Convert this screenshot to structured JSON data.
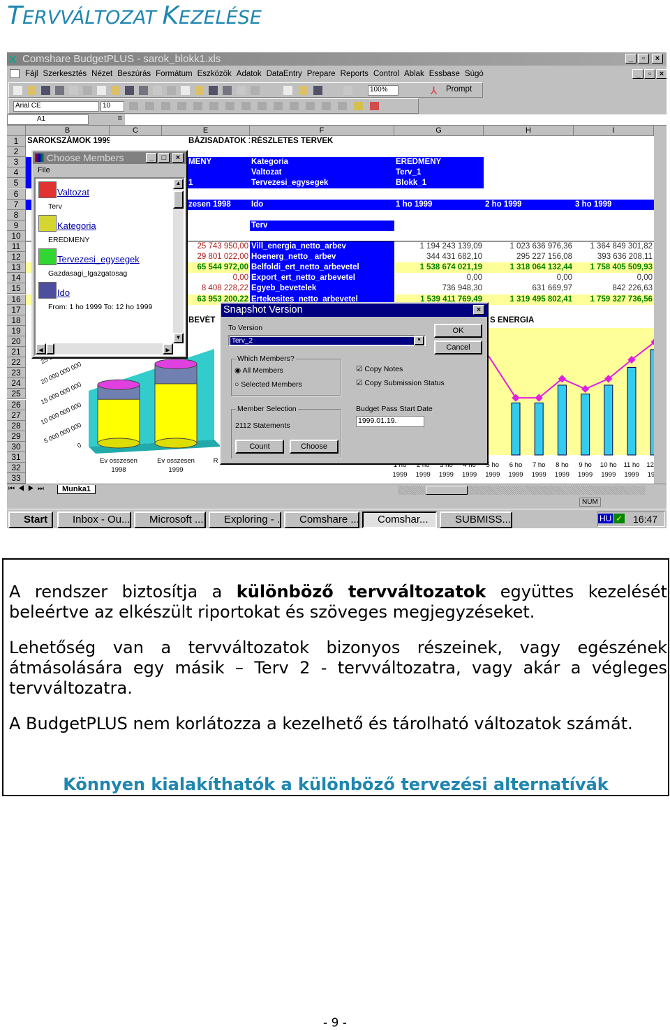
{
  "heading": {
    "first": "T",
    "rest1": "ERVVÁLTOZAT ",
    "k": "K",
    "rest2": "EZELÉSE"
  },
  "app": {
    "title": "Comshare BudgetPLUS - sarok_blokk1.xls",
    "menu": [
      "Fájl",
      "Szerkesztés",
      "Nézet",
      "Beszúrás",
      "Formátum",
      "Eszközök",
      "Adatok",
      "DataEntry",
      "Prepare",
      "Reports",
      "Control",
      "Ablak",
      "Essbase",
      "Súgó"
    ],
    "zoom": "100%",
    "prompt_label": "Prompt",
    "font_name": "Arial CE",
    "font_size": "10",
    "name_box": "A1",
    "formula_eq": "=",
    "columns": [
      "B",
      "C",
      "E",
      "F",
      "G",
      "H",
      "I"
    ],
    "cells": {
      "B1": "SAROKSZÁMOK 1999",
      "E1": "BÁZISADATOK 1998",
      "F1": "RÉSZLETES TERVEK",
      "E3": "MENY",
      "F3": "Kategoria",
      "G3": "EREDMENY",
      "F4": "Valtozat",
      "G4": "Terv_1",
      "E5": "1",
      "F5": "Tervezesi_egysegek",
      "G5": "Blokk_1",
      "E7": "zesen 1998",
      "F7": "Ido",
      "G7": "1 ho 1999",
      "H7": "2 ho 1999",
      "I7": "3 ho 1999",
      "F9": "Terv",
      "E11": "25 743 950,00",
      "F11": "Vill_energia_netto_arbev",
      "G11": "1 194 243 139,09",
      "H11": "1 023 636 976,36",
      "I11": "1 364 849 301,82",
      "E12": "29 801 022,00",
      "F12": "Hoenerg_netto_ arbev",
      "G12": "344 431 682,10",
      "H12": "295 227 156,08",
      "I12": "393 636 208,11",
      "E13": "65 544 972,00",
      "F13": "Belfoldi_ert_netto_arbevetel",
      "G13": "1 538 674 021,19",
      "H13": "1 318 064 132,44",
      "I13": "1 758 405 509,93",
      "E14": "0,00",
      "F14": "Export_ert_netto_arbevetel",
      "G14": "0,00",
      "H14": "0,00",
      "I14": "0,00",
      "E15": "8 408 228,22",
      "F15": "Egyeb_bevetelek",
      "G15": "736 948,30",
      "H15": "631 669,97",
      "I15": "842 226,63",
      "E16": "63 953 200,22",
      "F16": "Ertekesites_netto_arbevetel",
      "G16": "1 539 411 769,49",
      "H16": "1 319 495 802,41",
      "I16": "1 759 327 736,56",
      "E18": "BEVÉT",
      "G18": "S ENERGIA"
    },
    "sheet_tab": "Munka1",
    "status_num": "NUM",
    "left_chart": {
      "y_ticks": [
        "0",
        "5 000 000 000",
        "10 000 000 000",
        "15 000 000 000",
        "20 000 000 000",
        "25 000 000 000"
      ],
      "categories": [
        "Ev osszesen 1998",
        "Ev osszesen 1999",
        "R"
      ],
      "cat_line1": [
        "Ev osszesen",
        "Ev osszesen",
        "R"
      ],
      "cat_line2": [
        "1998",
        "1999",
        ""
      ],
      "bars_pct": [
        62,
        84
      ]
    },
    "right_chart": {
      "x_line1": [
        "1 ho",
        "2 ho",
        "3 ho",
        "4 ho",
        "5 ho",
        "6 ho",
        "7 ho",
        "8 ho",
        "9 ho",
        "10 ho",
        "11 ho",
        "12 ho"
      ],
      "x_line2": [
        "1999",
        "1999",
        "1999",
        "1999",
        "1999",
        "1999",
        "1999",
        "1999",
        "1999",
        "1999",
        "1999",
        "1999"
      ],
      "bars_pct": [
        null,
        null,
        null,
        null,
        null,
        41,
        41,
        55,
        48,
        55,
        69,
        83
      ],
      "line_pct": [
        null,
        null,
        null,
        null,
        null,
        45,
        45,
        60,
        52,
        60,
        75,
        89
      ],
      "bar_color": "#33ccee",
      "line_color": "#e020e0",
      "plot_bg": "#ffff99"
    },
    "choose_members": {
      "title": "Choose Members",
      "menu_file": "File",
      "items": [
        {
          "name": "Valtozat",
          "value": "Terv"
        },
        {
          "name": "Kategoria",
          "value": "EREDMENY"
        },
        {
          "name": "Tervezesi_egysegek",
          "value": "Gazdasagi_Igazgatosag"
        },
        {
          "name": "Ido",
          "value": "From: 1 ho 1999 To: 12 ho 1999"
        }
      ]
    },
    "snapshot": {
      "title": "Snapshot Version",
      "to_version_label": "To Version",
      "to_version_value": "Terv_2",
      "ok": "OK",
      "cancel": "Cancel",
      "which_members_label": "Which Members?",
      "all_members": "All Members",
      "selected_members": "Selected Members",
      "all_members_checked": true,
      "copy_notes": "Copy Notes",
      "copy_notes_checked": true,
      "copy_submission": "Copy Submission Status",
      "copy_submission_checked": true,
      "member_selection_label": "Member Selection",
      "member_selection_value": "2112 Statements",
      "count": "Count",
      "choose": "Choose",
      "budget_pass_label": "Budget Pass Start Date",
      "budget_pass_value": "1999.01.19."
    },
    "taskbar": {
      "start": "Start",
      "tasks": [
        "Inbox - Ou...",
        "Microsoft ...",
        "Exploring - ...",
        "Comshare ...",
        "Comshar...",
        "SUBMISS..."
      ],
      "lang": "HU",
      "clock": "16:47"
    }
  },
  "body": {
    "p1_a": "A rendszer biztosítja a ",
    "p1_b": "különböző tervváltozatok",
    "p1_c": " együttes kezelését beleértve az elkészült riportokat és szöveges megjegyzéseket.",
    "p2": "Lehetőség van a tervváltozatok bizonyos részeinek, vagy egészének átmásolására egy másik – Terv 2 - tervváltozatra, vagy akár a végleges tervváltozatra.",
    "p3": "A BudgetPLUS nem korlátozza a kezelhető és tárolható változatok számát.",
    "tagline": "Könnyen kialakíthatók a különböző tervezési alternatívák"
  },
  "page_number": "- 9 -"
}
